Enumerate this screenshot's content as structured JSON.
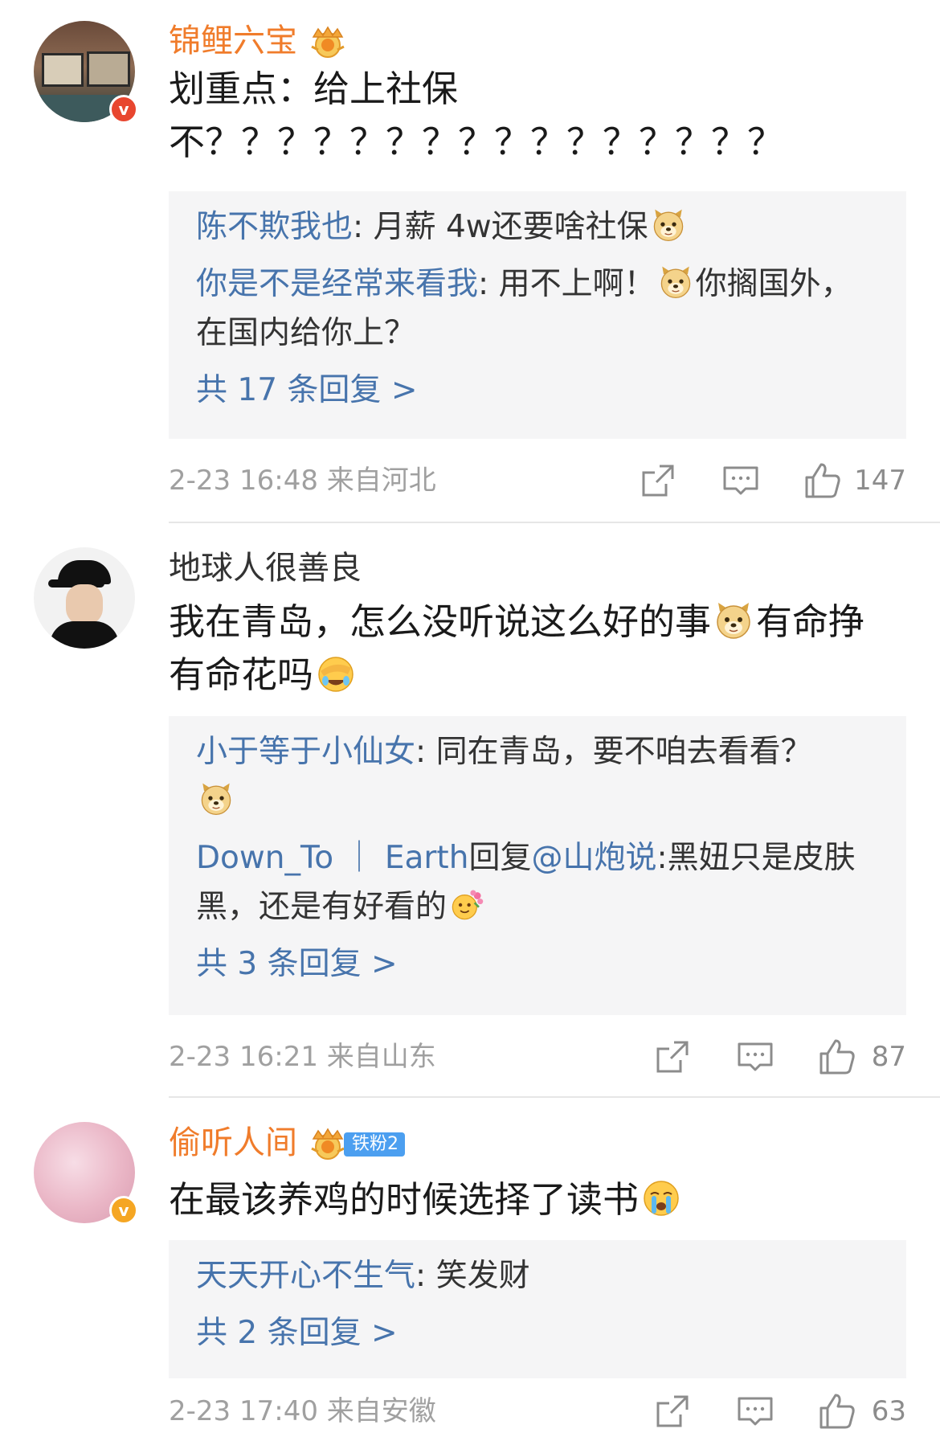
{
  "comments": [
    {
      "username": "锦鲤六宝",
      "body_lines": [
        "划重点：给上社保",
        "不？？？？？？？？？？？？？？？？"
      ],
      "replies": [
        {
          "name": "陈不欺我也",
          "sep": ": ",
          "text": "月薪 4w还要啥社保",
          "after": ""
        },
        {
          "name": "你是不是经常来看我",
          "sep": ": ",
          "text": "用不上啊！",
          "after": "你搁国外，在国内给你上？"
        }
      ],
      "more": "共 17 条回复 >",
      "timestamp": "2-23 16:48  来自河北",
      "likes": "147"
    },
    {
      "username": "地球人很善良",
      "body_a": "我在青岛，怎么没听说这么好的事",
      "body_b": "有命挣",
      "body_c": "有命花吗",
      "replies": [
        {
          "name": "小于等于小仙女",
          "sep": ": ",
          "text": "同在青岛，要不咱去看看？"
        },
        {
          "name": "Down_To ｜ Earth",
          "mid": "回复",
          "name2": "@山炮说",
          "sep": ":",
          "text": "黑妞只是皮肤黑，还是有好看的"
        }
      ],
      "more": "共 3 条回复 >",
      "timestamp": "2-23 16:21  来自山东",
      "likes": "87"
    },
    {
      "username": "偷听人间",
      "fan_badge": "铁粉2",
      "body": "在最该养鸡的时候选择了读书",
      "replies": [
        {
          "name": "天天开心不生气",
          "sep": ": ",
          "text": "笑发财"
        }
      ],
      "more": "共 2 条回复 >",
      "timestamp": "2-23 17:40  来自安徽",
      "likes": "63"
    }
  ],
  "icons": {
    "verified": "verified-v-icon",
    "crown": "crown-badge-icon",
    "share": "share-icon",
    "comment": "comment-icon",
    "like": "like-thumb-icon",
    "doge": "doge-emoji",
    "facepalm": "facepalm-laugh-emoji",
    "cry": "crying-emoji",
    "flower": "flower-face-emoji"
  },
  "colors": {
    "vip_name": "#f07c2b",
    "link": "#4774ac",
    "reply_bg": "#f5f5f6",
    "meta": "#a0a0a0",
    "verified_orange": "#f5a623",
    "verified_red": "#e8462f"
  }
}
